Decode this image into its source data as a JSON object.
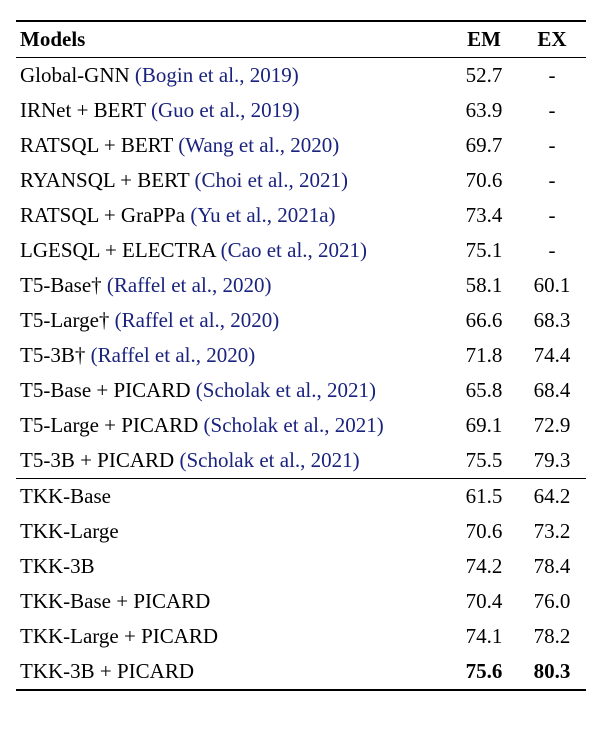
{
  "headers": {
    "models": "Models",
    "em": "EM",
    "ex": "EX"
  },
  "rows_section1": [
    {
      "model": "Global-GNN",
      "cite": "(Bogin et al., 2019)",
      "em": "52.7",
      "ex": "-"
    },
    {
      "model": "IRNet + BERT",
      "cite": "(Guo et al., 2019)",
      "em": "63.9",
      "ex": "-"
    },
    {
      "model": "RATSQL + BERT",
      "cite": "(Wang et al., 2020)",
      "em": "69.7",
      "ex": "-"
    },
    {
      "model": "RYANSQL + BERT",
      "cite": "(Choi et al., 2021)",
      "em": "70.6",
      "ex": "-"
    },
    {
      "model": "RATSQL + GraPPa",
      "cite": "(Yu et al., 2021a)",
      "em": "73.4",
      "ex": "-"
    },
    {
      "model": "LGESQL + ELECTRA",
      "cite": "(Cao et al., 2021)",
      "em": "75.1",
      "ex": "-"
    },
    {
      "model": "T5-Base†",
      "cite": "(Raffel et al., 2020)",
      "em": "58.1",
      "ex": "60.1"
    },
    {
      "model": "T5-Large†",
      "cite": "(Raffel et al., 2020)",
      "em": "66.6",
      "ex": "68.3"
    },
    {
      "model": "T5-3B†",
      "cite": "(Raffel et al., 2020)",
      "em": "71.8",
      "ex": "74.4"
    },
    {
      "model": "T5-Base + PICARD",
      "cite": "(Scholak et al., 2021)",
      "em": "65.8",
      "ex": "68.4"
    },
    {
      "model": "T5-Large + PICARD",
      "cite": "(Scholak et al., 2021)",
      "em": "69.1",
      "ex": "72.9"
    },
    {
      "model": "T5-3B + PICARD",
      "cite": "(Scholak et al., 2021)",
      "em": "75.5",
      "ex": "79.3"
    }
  ],
  "rows_section2": [
    {
      "model": "TKK-Base",
      "cite": "",
      "em": "61.5",
      "ex": "64.2",
      "bold": false
    },
    {
      "model": "TKK-Large",
      "cite": "",
      "em": "70.6",
      "ex": "73.2",
      "bold": false
    },
    {
      "model": "TKK-3B",
      "cite": "",
      "em": "74.2",
      "ex": "78.4",
      "bold": false
    },
    {
      "model": "TKK-Base + PICARD",
      "cite": "",
      "em": "70.4",
      "ex": "76.0",
      "bold": false
    },
    {
      "model": "TKK-Large + PICARD",
      "cite": "",
      "em": "74.1",
      "ex": "78.2",
      "bold": false
    },
    {
      "model": "TKK-3B + PICARD",
      "cite": "",
      "em": "75.6",
      "ex": "80.3",
      "bold": true
    }
  ]
}
